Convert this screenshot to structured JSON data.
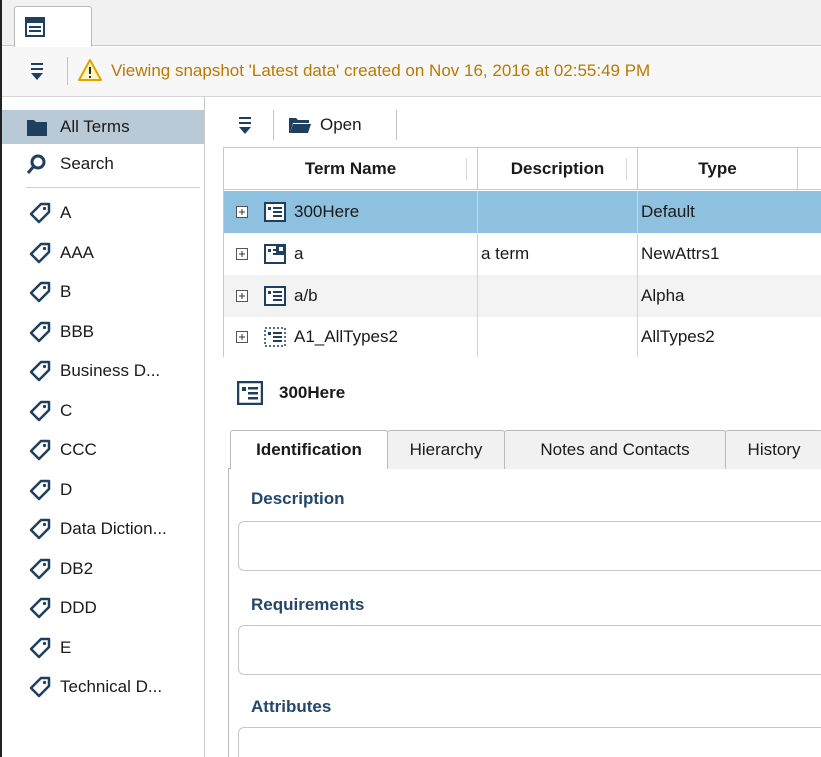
{
  "tabstrip": {
    "view_tab_icon": "glossary-view-icon"
  },
  "snapshot_bar": {
    "menu_icon": "menu-icon",
    "warning_icon": "warning-icon",
    "message": "Viewing snapshot 'Latest data' created on Nov 16, 2016 at 02:55:49 PM",
    "message_color": "#b87a00"
  },
  "sidebar": {
    "all_terms_label": "All Terms",
    "search_label": "Search",
    "tags": [
      "A",
      "AAA",
      "B",
      "BBB",
      "Business D...",
      "C",
      "CCC",
      "D",
      "Data Diction...",
      "DB2",
      "DDD",
      "E",
      "Technical D..."
    ]
  },
  "toolbar": {
    "menu_icon": "menu-icon",
    "open_label": "Open"
  },
  "table": {
    "columns": [
      "Term Name",
      "Description",
      "Type"
    ],
    "rows": [
      {
        "name": "300Here",
        "description": "",
        "type": "Default",
        "icon": "term-icon"
      },
      {
        "name": "a",
        "description": "a term",
        "type": "NewAttrs1",
        "icon": "term-locked-icon"
      },
      {
        "name": "a/b",
        "description": "",
        "type": "Alpha",
        "icon": "term-icon"
      },
      {
        "name": "A1_AllTypes2",
        "description": "",
        "type": "AllTypes2",
        "icon": "term-dotted-icon"
      }
    ]
  },
  "detail": {
    "title": "300Here",
    "tabs": [
      "Identification",
      "Hierarchy",
      "Notes and Contacts",
      "History"
    ],
    "active_tab": "Identification",
    "sections": {
      "description_label": "Description",
      "requirements_label": "Requirements",
      "attributes_label": "Attributes"
    }
  },
  "colors": {
    "selection": "#8ec0e0",
    "sidebar_selected": "#b9c9d6",
    "section_label": "#24476b"
  }
}
